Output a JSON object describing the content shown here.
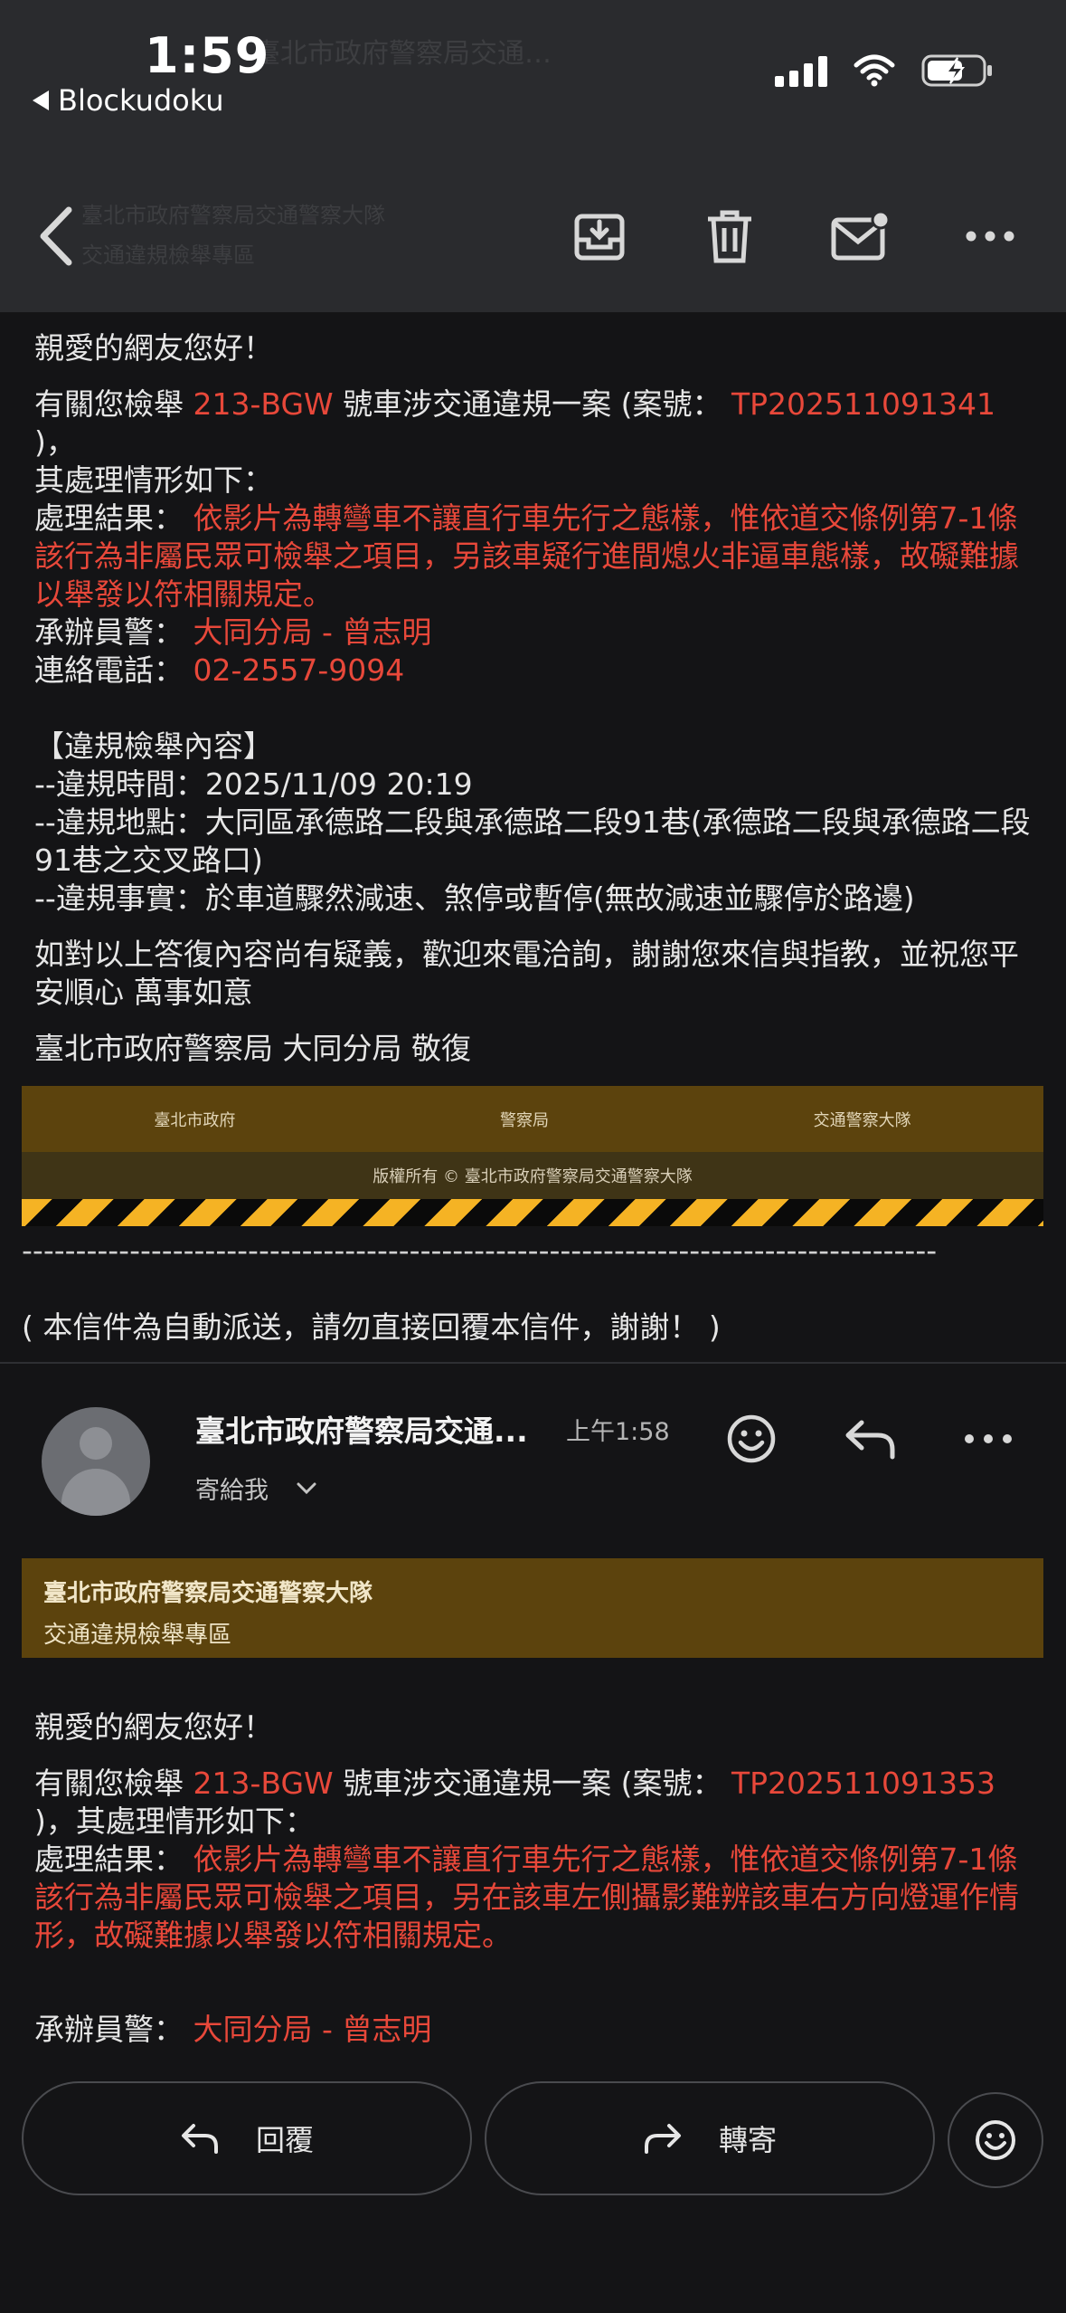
{
  "status_bar": {
    "time": "1:59",
    "back_app": "Blockudoku"
  },
  "header": {
    "ghost_title": "臺北市政府警察局交通…",
    "ghost_sub1": "臺北市政府警察局交通警察大隊",
    "ghost_sub2": "交通違規檢舉專區"
  },
  "message1": {
    "greeting": "親愛的網友您好！",
    "l1_pre": "有關您檢舉 ",
    "plate": "213-BGW",
    "l1_mid": " 號車涉交通違規一案 (案號： ",
    "case_no": "TP202511091341",
    "l1_post": " )，",
    "l2": "其處理情形如下：",
    "result_label": "處理結果： ",
    "result_text": "依影片為轉彎車不讓直行車先行之態樣，惟依道交條例第7-1條該行為非屬民眾可檢舉之項目，另該車疑行進間熄火非逼車態樣，故礙難據以舉發以符相關規定。",
    "officer_label": "承辦員警： ",
    "officer": "大同分局 - 曾志明",
    "phone_label": "連絡電話： ",
    "phone": "02-2557-9094",
    "section_title": "【違規檢舉內容】",
    "time_line": "--違規時間：2025/11/09 20:19",
    "place_line": "--違規地點：大同區承德路二段與承德路二段91巷(承德路二段與承德路二段91巷之交叉路口)",
    "fact_line": "--違規事實：於車道驟然減速、煞停或暫停(無故減速並驟停於路邊)",
    "closing": "如對以上答復內容尚有疑義，歡迎來電洽詢，謝謝您來信與指教，並祝您平安順心 萬事如意",
    "signature": "臺北市政府警察局 大同分局 敬復"
  },
  "footer": {
    "links": [
      "臺北市政府",
      "警察局",
      "交通警察大隊"
    ],
    "copyright": "版權所有 © 臺北市政府警察局交通警察大隊",
    "dashes": "-------------------------------------------------------------------------------------",
    "auto_note": "( 本信件為自動派送，請勿直接回覆本信件，謝謝！ )"
  },
  "message2": {
    "sender": "臺北市政府警察局交通...",
    "time": "上午1:58",
    "to": "寄給我",
    "banner_title": "臺北市政府警察局交通警察大隊",
    "banner_sub": "交通違規檢舉專區",
    "greeting": "親愛的網友您好！",
    "l1_pre": "有關您檢舉 ",
    "plate": "213-BGW",
    "l1_mid": " 號車涉交通違規一案 (案號： ",
    "case_no": "TP202511091353",
    "l2": ")，其處理情形如下：",
    "result_label": "處理結果： ",
    "result_text": "依影片為轉彎車不讓直行車先行之態樣，惟依道交條例第7-1條該行為非屬民眾可檢舉之項目，另在該車左側攝影難辨該車右方向燈運作情形，故礙難據以舉發以符相關規定。",
    "officer_label": "承辦員警： ",
    "officer": "大同分局 - 曾志明"
  },
  "actions": {
    "reply": "回覆",
    "forward": "轉寄"
  }
}
